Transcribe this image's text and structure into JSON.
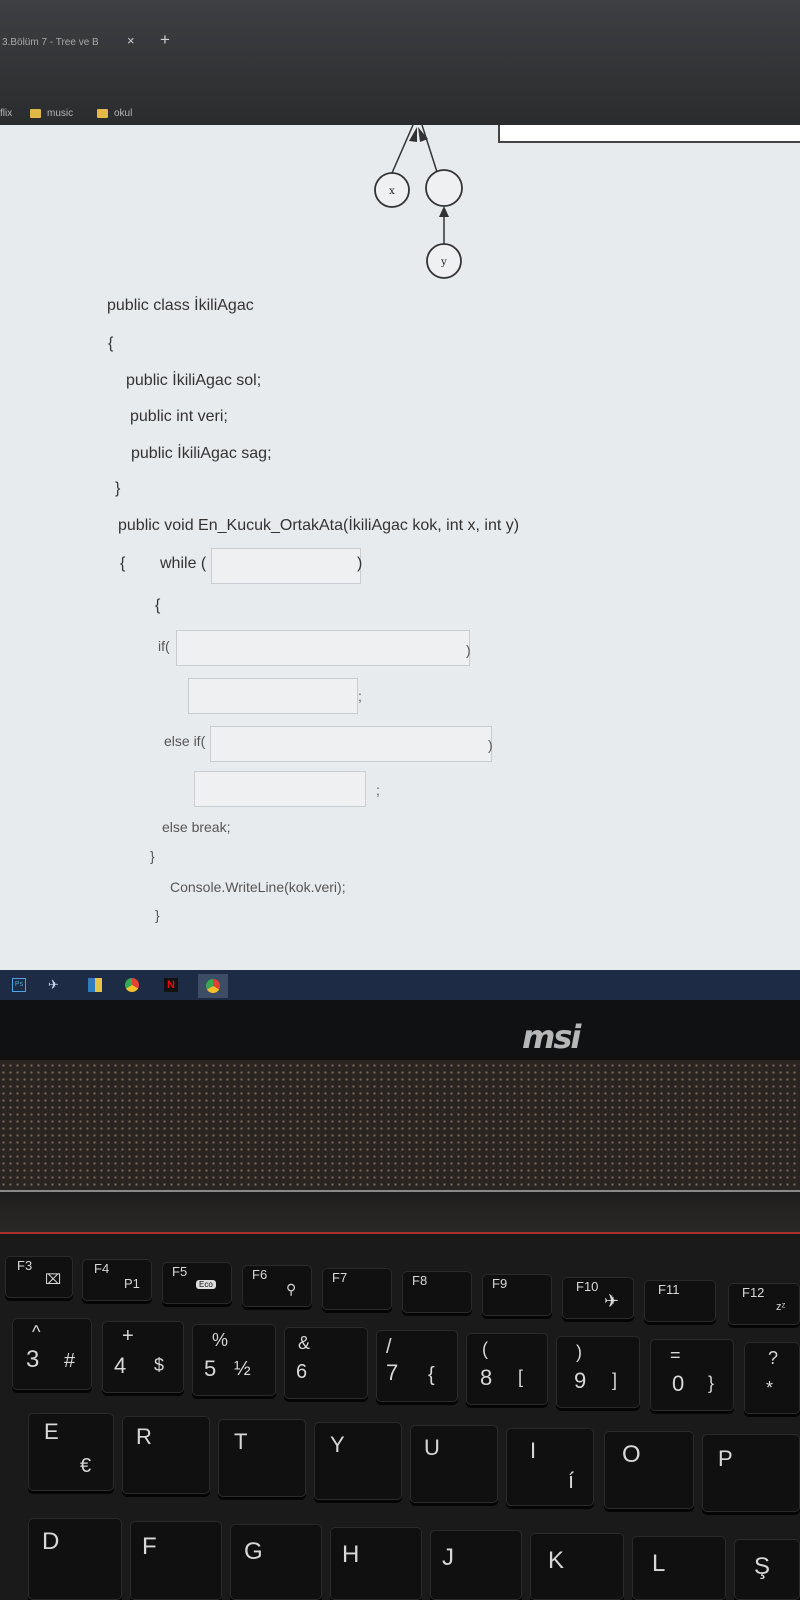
{
  "browser": {
    "tab_title": "3.Bölüm 7 - Tree ve B",
    "tab_close": "×",
    "new_tab": "+",
    "bookmarks": [
      "flix",
      "music",
      "okul"
    ]
  },
  "diagram": {
    "node_x": "x",
    "node_y": "y"
  },
  "code": {
    "class_decl": "public class İkiliAgac",
    "open1": "{",
    "field_sol": "public İkiliAgac sol;",
    "field_veri": "public int veri;",
    "field_sag": "public İkiliAgac sag;",
    "close1": "}",
    "method_decl": "public void En_Kucuk_OrtakAta(İkiliAgac kok, int x, int y)",
    "open2": "{",
    "while_kw": "while (",
    "while_close": ")",
    "open3": "{",
    "if_kw": "if(",
    "if_close": ")",
    "semi1": ";",
    "elseif_kw": "else if(",
    "elseif_close": ")",
    "semi2": ";",
    "else_break": "else break;",
    "close3": "}",
    "writeline": "Console.WriteLine(kok.veri);",
    "close2": "}"
  },
  "taskbar": {
    "apps": [
      "photoshop",
      "steam",
      "files",
      "chrome",
      "netflix",
      "chrome-active"
    ]
  },
  "laptop": {
    "brand": "msi"
  },
  "keyboard": {
    "fn_row": [
      {
        "main": "F3",
        "sub": "⌧"
      },
      {
        "main": "F4",
        "sub": "P1"
      },
      {
        "main": "F5",
        "sub": "Eco"
      },
      {
        "main": "F6",
        "sub": "⚲"
      },
      {
        "main": "F7",
        "sub": ""
      },
      {
        "main": "F8",
        "sub": ""
      },
      {
        "main": "F9",
        "sub": ""
      },
      {
        "main": "F10",
        "sub": "✈"
      },
      {
        "main": "F11",
        "sub": ""
      },
      {
        "main": "F12",
        "sub": "zᶻ"
      }
    ],
    "num_row": [
      {
        "top": "^",
        "main": "3",
        "alt": "#"
      },
      {
        "top": "+",
        "main": "4",
        "alt": "$"
      },
      {
        "top": "%",
        "main": "5",
        "alt": "½"
      },
      {
        "top": "&",
        "main": "6",
        "alt": ""
      },
      {
        "top": "/",
        "main": "7",
        "alt": "{"
      },
      {
        "top": "(",
        "main": "8",
        "alt": "["
      },
      {
        "top": ")",
        "main": "9",
        "alt": "]"
      },
      {
        "top": "=",
        "main": "0",
        "alt": "}"
      },
      {
        "top": "?",
        "main": "",
        "alt": "*"
      }
    ],
    "q_row": [
      {
        "main": "E",
        "alt": "€"
      },
      {
        "main": "R",
        "alt": ""
      },
      {
        "main": "T",
        "alt": ""
      },
      {
        "main": "Y",
        "alt": ""
      },
      {
        "main": "U",
        "alt": ""
      },
      {
        "main": "I",
        "alt": "í"
      },
      {
        "main": "O",
        "alt": ""
      },
      {
        "main": "P",
        "alt": ""
      }
    ],
    "a_row": [
      {
        "main": "D",
        "alt": ""
      },
      {
        "main": "F",
        "alt": ""
      },
      {
        "main": "G",
        "alt": ""
      },
      {
        "main": "H",
        "alt": ""
      },
      {
        "main": "J",
        "alt": ""
      },
      {
        "main": "K",
        "alt": ""
      },
      {
        "main": "L",
        "alt": ""
      },
      {
        "main": "Ş",
        "alt": ""
      }
    ]
  }
}
